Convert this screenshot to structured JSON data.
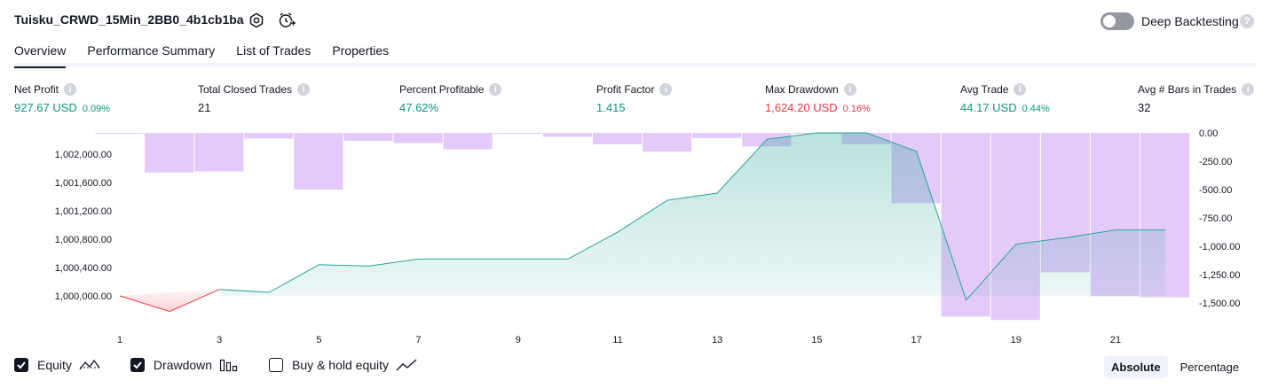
{
  "header": {
    "title": "Tuisku_CRWD_15Min_2BB0_4b1cb1ba",
    "deep_backtesting_label": "Deep Backtesting",
    "deep_backtesting_on": false,
    "help_glyph": "?"
  },
  "tabs": [
    {
      "label": "Overview",
      "active": true
    },
    {
      "label": "Performance Summary",
      "active": false
    },
    {
      "label": "List of Trades",
      "active": false
    },
    {
      "label": "Properties",
      "active": false
    }
  ],
  "stats": [
    {
      "label": "Net Profit",
      "value": "927.67 USD",
      "pct": "0.09%",
      "color": "green"
    },
    {
      "label": "Total Closed Trades",
      "value": "21",
      "pct": "",
      "color": "plain"
    },
    {
      "label": "Percent Profitable",
      "value": "47.62%",
      "pct": "",
      "color": "green"
    },
    {
      "label": "Profit Factor",
      "value": "1.415",
      "pct": "",
      "color": "green"
    },
    {
      "label": "Max Drawdown",
      "value": "1,624.20 USD",
      "pct": "0.16%",
      "color": "red"
    },
    {
      "label": "Avg Trade",
      "value": "44.17 USD",
      "pct": "0.44%",
      "color": "green"
    },
    {
      "label": "Avg # Bars in Trades",
      "value": "32",
      "pct": "",
      "color": "plain"
    }
  ],
  "info_glyph": "i",
  "chart_data": {
    "type": "line",
    "x": [
      1,
      2,
      3,
      4,
      5,
      6,
      7,
      8,
      9,
      10,
      11,
      12,
      13,
      14,
      15,
      16,
      17,
      18,
      19,
      20,
      21,
      22
    ],
    "x_tick_labels": [
      "1",
      "3",
      "5",
      "7",
      "9",
      "11",
      "13",
      "15",
      "17",
      "19",
      "21"
    ],
    "y_left_tick_labels": [
      "1,002,000.00",
      "1,001,600.00",
      "1,001,200.00",
      "1,000,800.00",
      "1,000,400.00",
      "1,000,000.00"
    ],
    "y_left_ticks": [
      1002000,
      1001600,
      1001200,
      1000800,
      1000400,
      1000000
    ],
    "y_right_tick_labels": [
      "0.00",
      "-250.00",
      "-500.00",
      "-750.00",
      "-1,000.00",
      "-1,250.00",
      "-1,500.00"
    ],
    "y_right_ticks": [
      0,
      -250,
      -500,
      -750,
      -1000,
      -1250,
      -1500
    ],
    "series": [
      {
        "name": "Equity",
        "axis": "left",
        "values": [
          1000000,
          999780,
          1000090,
          1000050,
          1000440,
          1000420,
          1000520,
          1000520,
          1000520,
          1000520,
          1000900,
          1001350,
          1001450,
          1002210,
          1002300,
          1002300,
          1002040,
          999940,
          1000730,
          1000820,
          1000930,
          1000930
        ]
      },
      {
        "name": "Drawdown",
        "axis": "right",
        "values": [
          0,
          -350,
          -340,
          -50,
          -500,
          -70,
          -90,
          -145,
          0,
          -35,
          -100,
          -165,
          -45,
          -120,
          0,
          -100,
          -620,
          -1620,
          -1650,
          -1230,
          -1440,
          -1450
        ]
      }
    ],
    "colors": {
      "equity_line": "#26a69a",
      "equity_loss": "#f23645",
      "drawdown": "#e1c4fa"
    }
  },
  "legend": [
    {
      "label": "Equity",
      "checked": true,
      "icon": "equity-line-icon"
    },
    {
      "label": "Drawdown",
      "checked": true,
      "icon": "drawdown-bars-icon"
    },
    {
      "label": "Buy & hold equity",
      "checked": false,
      "icon": "buy-hold-line-icon"
    }
  ],
  "mode": {
    "absolute": "Absolute",
    "percentage": "Percentage",
    "active": "absolute"
  }
}
